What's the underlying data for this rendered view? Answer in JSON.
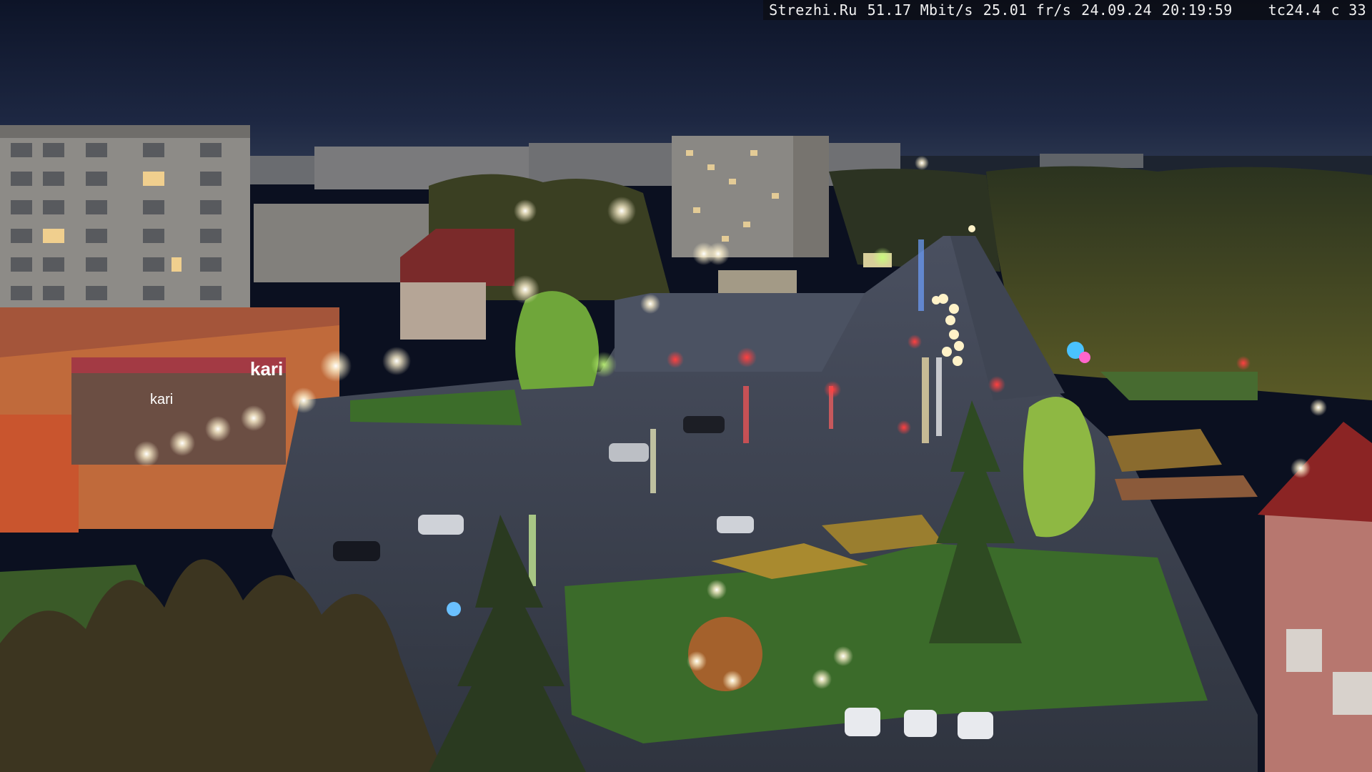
{
  "overlay": {
    "source": "Strezhi.Ru",
    "bitrate": "51.17 Mbit/s",
    "framerate": "25.01 fr/s",
    "date": "24.09.24",
    "time": "20:19:59",
    "tc": "tc24.4",
    "channel": "c 33"
  },
  "signs": {
    "store": "kari",
    "store_small": "kari"
  },
  "colors": {
    "sky_top": "#10182f",
    "sky_bottom": "#2a3552",
    "wet_asphalt": "#3b4150",
    "grass": "#3f6a2c",
    "building_panel": "#8c8a86",
    "shop_facade": "#c86a3c",
    "lamp_light": "#fff6d8",
    "traffic_red": "#ff3b3b"
  }
}
